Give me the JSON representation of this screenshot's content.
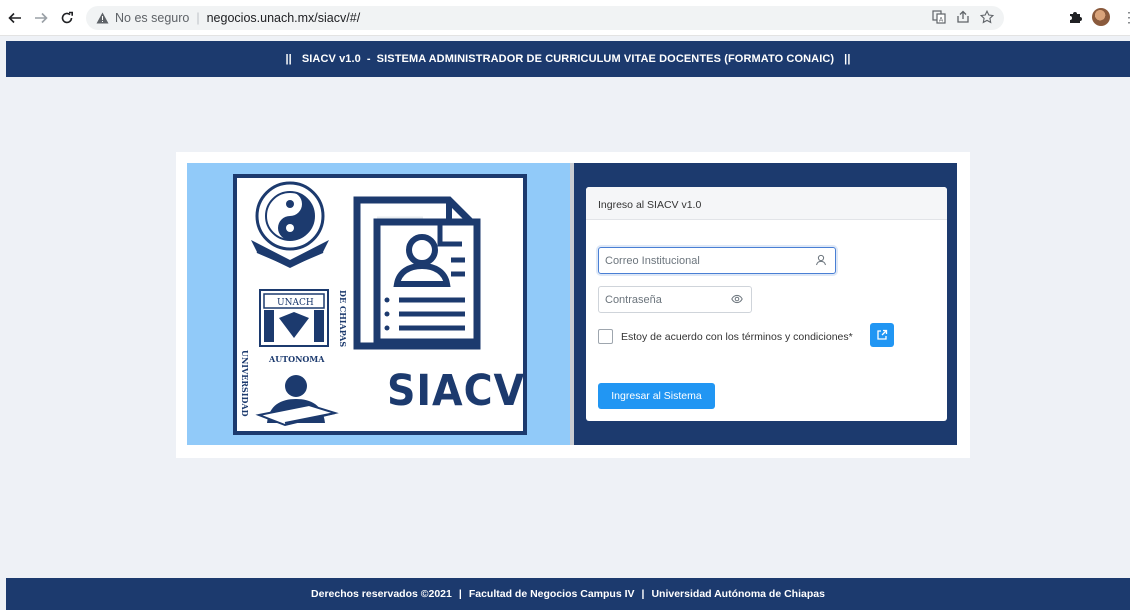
{
  "browser": {
    "security_label": "No es seguro",
    "url": "negocios.unach.mx/siacv/#/"
  },
  "header": {
    "left_bar": "||",
    "app_name": "SIACV v1.0",
    "dash": "-",
    "full_title": "SISTEMA ADMINISTRADOR DE CURRICULUM VITAE DOCENTES (FORMATO CONAIC)",
    "right_bar": "||"
  },
  "logo": {
    "siacv_text": "SIACV",
    "university_left": "UNIVERSIDAD",
    "university_right": "DE CHIAPAS",
    "university_bottom": "AUTONOMA",
    "badge_text": "UNACH"
  },
  "login": {
    "title": "Ingreso al SIACV v1.0",
    "email_placeholder": "Correo Institucional",
    "password_placeholder": "Contraseña",
    "terms_label": "Estoy de acuerdo con los términos y condiciones*",
    "submit_label": "Ingresar al Sistema"
  },
  "footer": {
    "rights": "Derechos reservados ©2021",
    "pipe1": "|",
    "faculty": "Facultad de Negocios Campus IV",
    "pipe2": "|",
    "university": "Universidad Autónoma de Chiapas"
  },
  "colors": {
    "primary_navy": "#1c3a6e",
    "accent_blue": "#2196f3",
    "panel_lightblue": "#91caf9",
    "background": "#eef1f6"
  },
  "icons": {
    "back": "arrow-left-icon",
    "forward": "arrow-right-icon",
    "reload": "reload-icon",
    "warning": "warning-icon",
    "translate": "translate-icon",
    "share": "share-icon",
    "bookmark": "star-icon",
    "extensions": "puzzle-icon",
    "profile": "avatar",
    "menu": "kebab-menu-icon",
    "user": "user-icon",
    "eye": "eye-icon",
    "external_link": "external-link-icon"
  }
}
